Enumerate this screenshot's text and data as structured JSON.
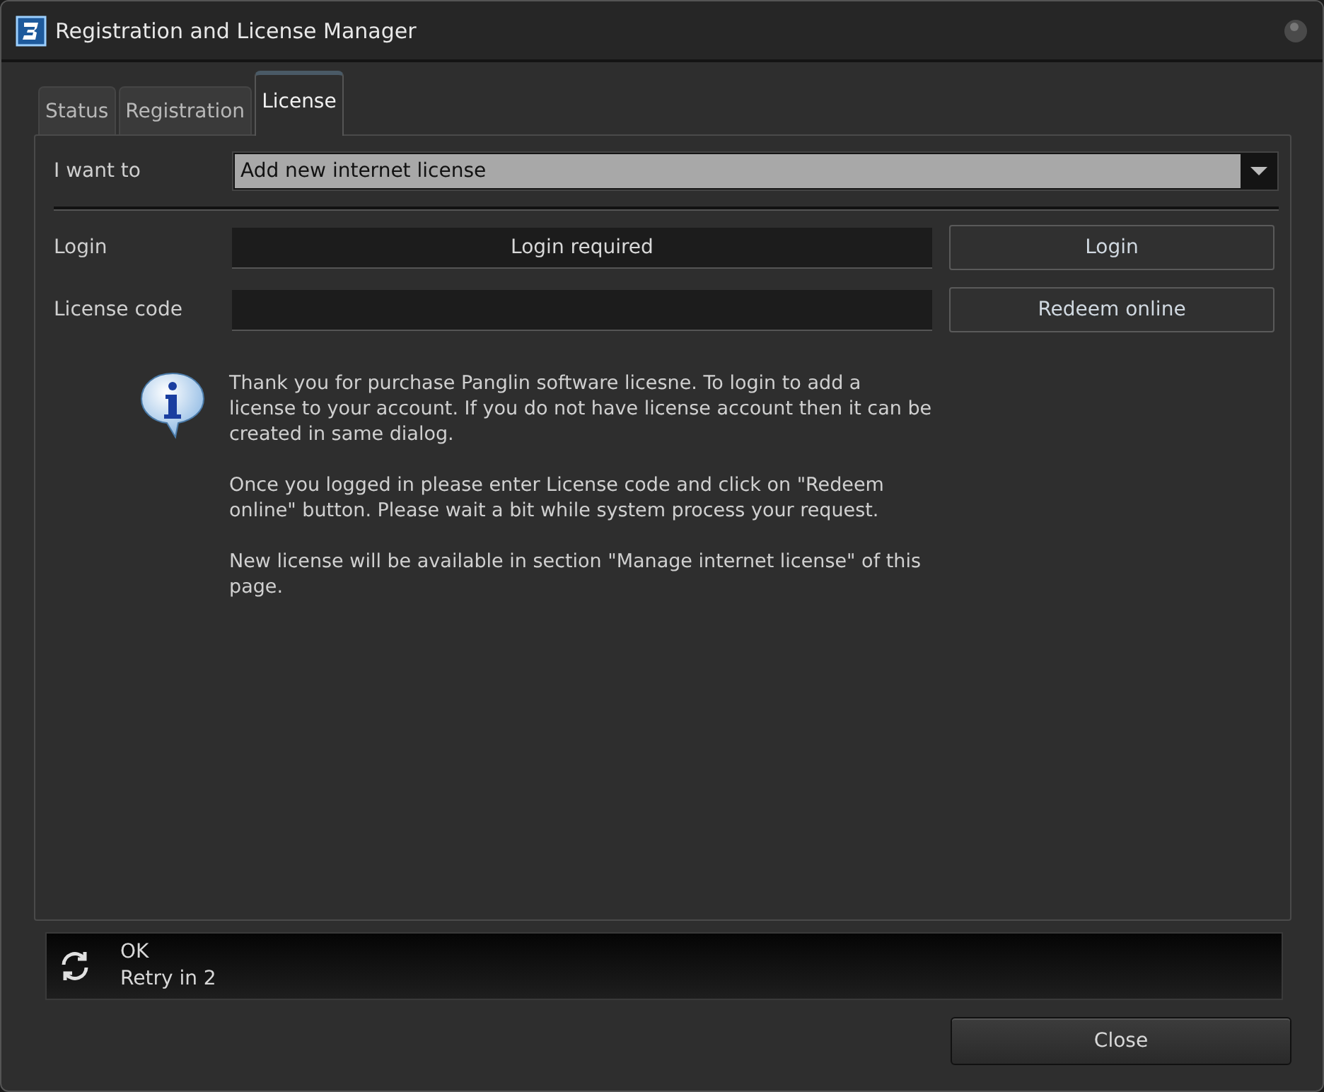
{
  "window": {
    "title": "Registration and License Manager"
  },
  "tabs": [
    {
      "label": "Status",
      "selected": false
    },
    {
      "label": "Registration",
      "selected": false
    },
    {
      "label": "License",
      "selected": true
    }
  ],
  "action": {
    "label": "I want to",
    "value": "Add new internet license"
  },
  "login": {
    "label": "Login",
    "value": "Login required",
    "button": "Login"
  },
  "license_code": {
    "label": "License code",
    "button": "Redeem online"
  },
  "info": [
    "Thank you for purchase Panglin software licesne. To login to add a license to your account. If you do not have license account then it can be created in same dialog.",
    "Once you logged in please enter License code and click on \"Redeem online\" button. Please wait a bit while system process your request.",
    "New license will be available in section \"Manage internet license\" of this page."
  ],
  "status_bar": {
    "status": "OK",
    "detail": "Retry in 2"
  },
  "buttons": [
    "Close"
  ]
}
